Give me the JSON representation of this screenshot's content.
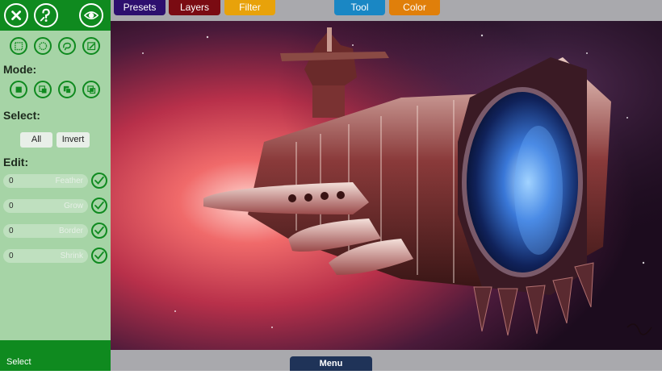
{
  "toolbar": {
    "presets_label": "Presets",
    "layers_label": "Layers",
    "filter_label": "Filter",
    "tool_label": "Tool",
    "color_label": "Color"
  },
  "panel": {
    "top_icons": [
      "close-icon",
      "help-icon",
      "visibility-icon"
    ],
    "selection_tool_icons": [
      "rect-select-icon",
      "ellipse-select-icon",
      "lasso-icon",
      "magic-wand-icon"
    ],
    "mode_title": "Mode:",
    "mode_icons": [
      "mode-replace-icon",
      "mode-add-icon",
      "mode-subtract-icon",
      "mode-intersect-icon"
    ],
    "select_title": "Select:",
    "select_all_label": "All",
    "select_invert_label": "Invert",
    "edit_title": "Edit:",
    "edit_fields": [
      {
        "value": "0",
        "label": "Feather"
      },
      {
        "value": "0",
        "label": "Grow"
      },
      {
        "value": "0",
        "label": "Border"
      },
      {
        "value": "0",
        "label": "Shrink"
      }
    ],
    "footer_label": "Select"
  },
  "bottom": {
    "menu_label": "Menu"
  },
  "colors": {
    "panel_green": "#0f8a1f",
    "panel_light": "#a6d4a6",
    "presets": "#2d0f6e",
    "layers": "#7a0b12",
    "filter": "#e8a20a",
    "tool": "#1a87c4",
    "color": "#e07f0a",
    "menu": "#1f3358"
  }
}
